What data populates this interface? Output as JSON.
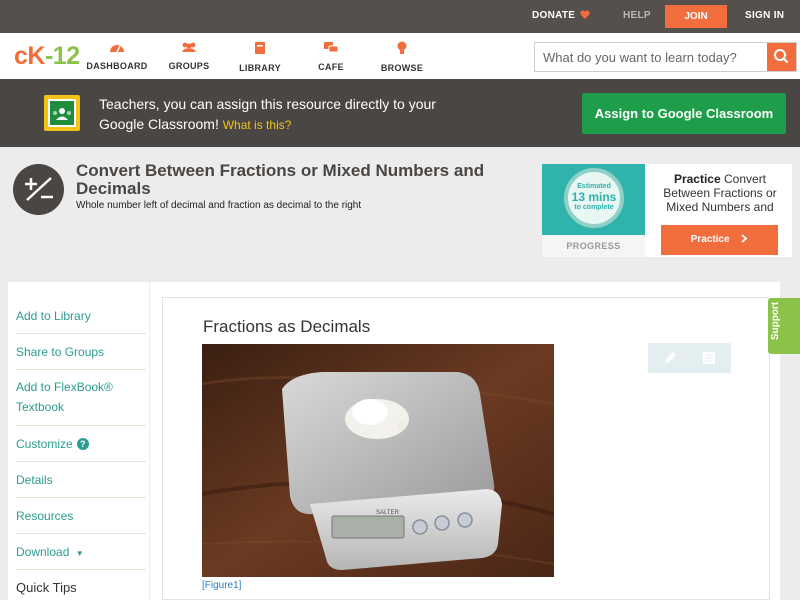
{
  "topbar": {
    "donate": "DONATE",
    "help": "HELP",
    "join": "JOIN",
    "signin": "SIGN IN"
  },
  "nav": {
    "logo_left": "cK",
    "logo_right": "-12",
    "items": [
      "DASHBOARD",
      "GROUPS",
      "LIBRARY",
      "CAFE",
      "BROWSE"
    ],
    "search_placeholder": "What do you want to learn today?"
  },
  "classroom": {
    "text": "Teachers, you can assign this resource directly to your Google Classroom!",
    "what": "What is this?",
    "button": "Assign to Google Classroom"
  },
  "concept": {
    "title": "Convert Between Fractions or Mixed Numbers and Decimals",
    "subtitle": "Whole number left of decimal and fraction as decimal to the right"
  },
  "practice": {
    "estimated_label": "Estimated",
    "mins": "13 mins",
    "to_complete": "to complete",
    "progress_label": "PROGRESS",
    "card_bold": "Practice",
    "card_text": "Convert Between Fractions or Mixed Numbers and",
    "button": "Practice"
  },
  "sidebar": {
    "items": [
      "Add to Library",
      "Share to Groups",
      "Add to FlexBook® Textbook",
      "Customize",
      "Details",
      "Resources",
      "Download"
    ],
    "help_glyph": "?",
    "download_caret": "▼",
    "quick_tips": "Quick Tips"
  },
  "content": {
    "title": "Fractions as Decimals",
    "figure_caption": "[Figure1]",
    "scale_brand": "SALTER"
  },
  "support": "Support",
  "colors": {
    "accent": "#f26d3d",
    "brand_green": "#8bc34a",
    "classroom_green": "#1e9e4a",
    "link_teal": "#2a9d8f"
  }
}
